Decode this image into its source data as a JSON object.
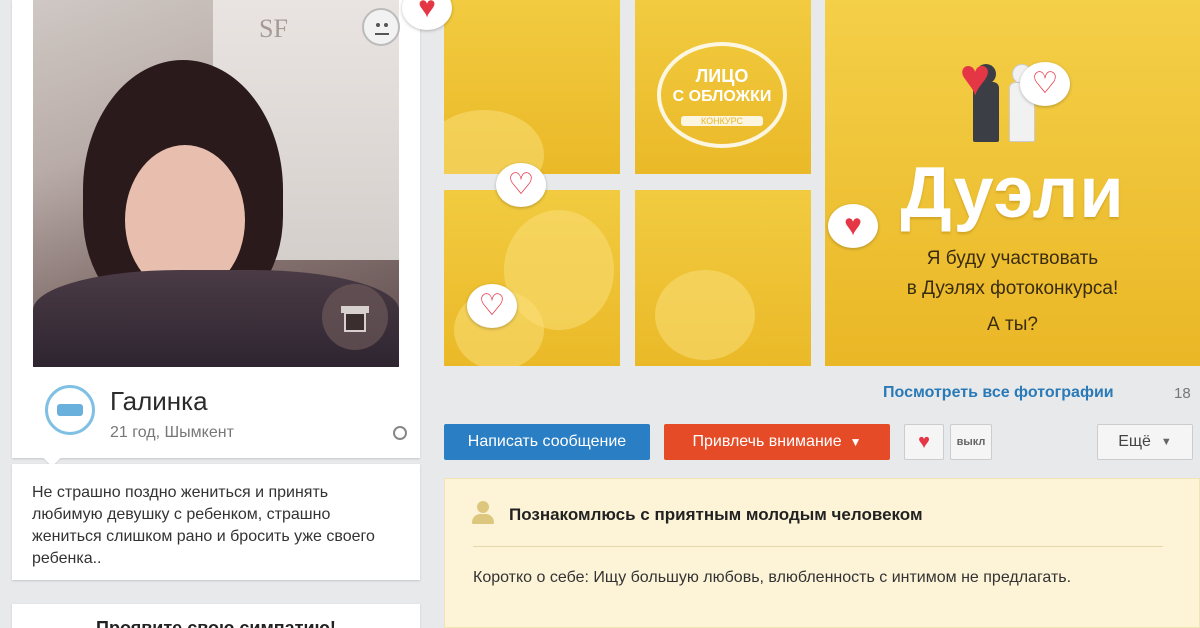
{
  "profile": {
    "name": "Галинка",
    "meta": "21 год, Шымкент",
    "status": "Не страшно поздно жениться и принять любимую девушку с ребенком, страшно жениться слишком рано и бросить уже своего ребенка..",
    "sympathy_title": "Проявите свою симпатию!"
  },
  "photos": {
    "cover_badge": {
      "line1": "ЛИЦО",
      "line2": "С ОБЛОЖКИ",
      "line3": "КОНКУРС"
    },
    "duel": {
      "title": "Дуэли",
      "line1": "Я буду участвовать",
      "line2": "в Дуэлях фотоконкурса!",
      "line3": "А ты?"
    },
    "watermark": "SF",
    "all_link": "Посмотреть все фотографии",
    "count": "18"
  },
  "actions": {
    "message": "Написать сообщение",
    "attention": "Привлечь внимание",
    "attention_chevron": "chevron-down-icon",
    "off": "выкл",
    "more": "Ещё"
  },
  "about": {
    "heading": "Познакомлюсь с приятным молодым человеком",
    "text": "Коротко о себе: Ищу большую любовь, влюбленность с интимом не предлагать."
  },
  "colors": {
    "primary": "#2a7ec4",
    "attention": "#e64b27",
    "heart": "#e53646",
    "tile": "#f0c437"
  }
}
